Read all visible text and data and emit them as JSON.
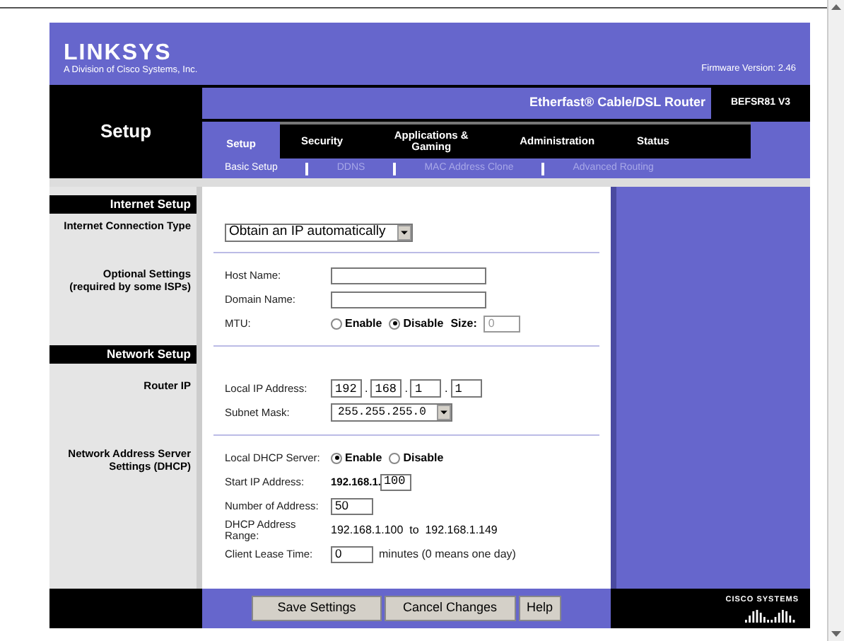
{
  "header": {
    "logo": "LINKSYS",
    "tagline": "A Division of Cisco Systems, Inc.",
    "firmware": "Firmware Version: 2.46"
  },
  "section_title": "Setup",
  "product_name": "Etherfast® Cable/DSL Router",
  "model": "BEFSR81 V3",
  "tabs": [
    {
      "label": "Setup",
      "selected": true
    },
    {
      "label": "Security",
      "selected": false
    },
    {
      "label": "Applications & Gaming",
      "selected": false
    },
    {
      "label": "Administration",
      "selected": false
    },
    {
      "label": "Status",
      "selected": false
    }
  ],
  "subtabs": [
    {
      "label": "Basic Setup",
      "selected": true
    },
    {
      "label": "DDNS",
      "selected": false
    },
    {
      "label": "MAC Address Clone",
      "selected": false
    },
    {
      "label": "Advanced Routing",
      "selected": false
    }
  ],
  "sections": [
    {
      "title": "Internet Setup",
      "groups": [
        {
          "label": "Internet Connection Type",
          "fields": [
            {
              "kind": "select",
              "value": "Obtain an IP automatically"
            }
          ]
        },
        {
          "label": "Optional Settings (required by some ISPs)",
          "fields": [
            {
              "kind": "text",
              "label": "Host Name:"
            },
            {
              "kind": "text",
              "label": "Domain Name:"
            },
            {
              "kind": "radio",
              "label": "MTU:",
              "options": [
                {
                  "label": "Enable",
                  "selected": false
                },
                {
                  "label": "Disable",
                  "selected": true
                }
              ],
              "extra_label": "Size:",
              "extra_value": "0"
            }
          ]
        }
      ]
    },
    {
      "title": "Network Setup",
      "groups": [
        {
          "label": "Router IP",
          "fields": [
            {
              "kind": "ip",
              "label": "Local IP Address:",
              "octets": [
                "192",
                "168",
                "1",
                "1"
              ],
              "separator": "."
            },
            {
              "kind": "select",
              "label": "Subnet Mask:",
              "value": "255.255.255.0"
            }
          ]
        },
        {
          "label": "Network Address Server Settings (DHCP)",
          "fields": [
            {
              "kind": "radio",
              "label": "Local DHCP Server:",
              "options": [
                {
                  "label": "Enable",
                  "selected": true
                },
                {
                  "label": "Disable",
                  "selected": false
                }
              ]
            },
            {
              "kind": "prefix",
              "label": "Start IP Address:",
              "prefix": "192.168.1.",
              "value": "100"
            },
            {
              "kind": "short_text",
              "label": "Number of Address:",
              "value": "50"
            },
            {
              "kind": "static",
              "label": "DHCP Address Range:",
              "value": "192.168.1.100  to  192.168.1.149"
            },
            {
              "kind": "short_text",
              "label": "Client Lease Time:",
              "value": "0",
              "suffix": "minutes (0 means one day)"
            }
          ]
        }
      ]
    }
  ],
  "buttons": [
    "Save Settings",
    "Cancel Changes",
    "Help"
  ],
  "cisco_logo": "CISCO SYSTEMS"
}
